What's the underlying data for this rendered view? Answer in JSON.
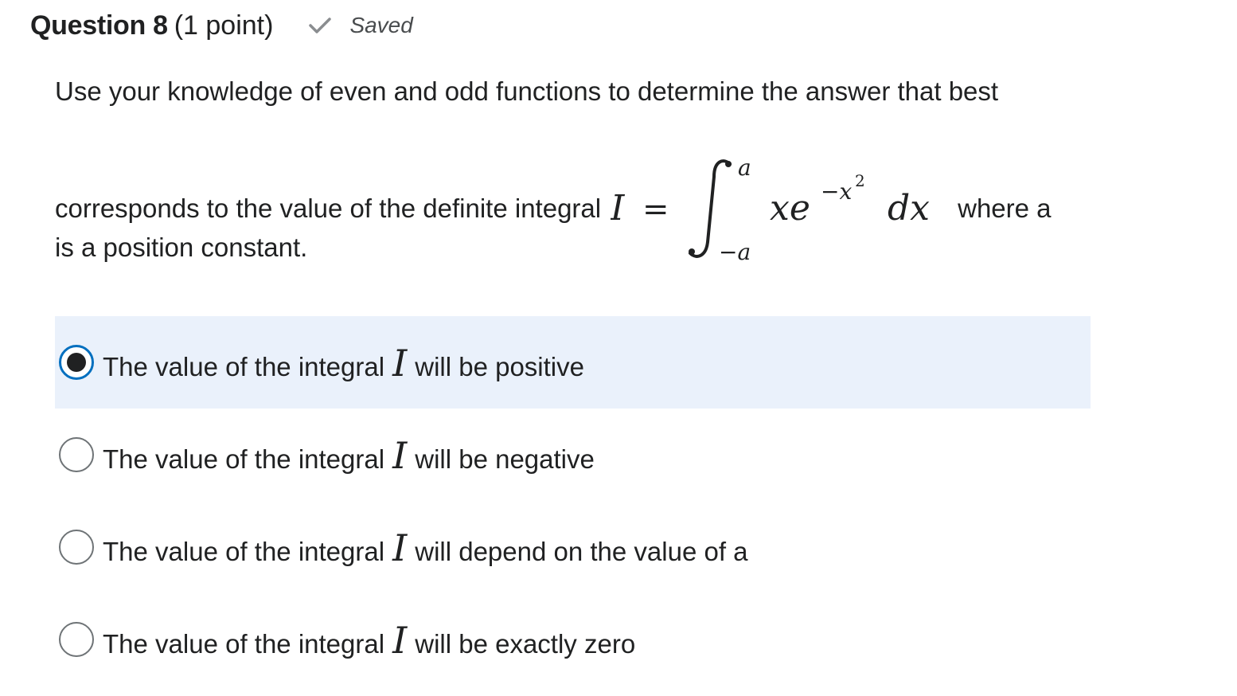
{
  "header": {
    "question_label": "Question 8",
    "points": "(1 point)",
    "status_icon": "check-icon",
    "status_text": "Saved"
  },
  "question": {
    "line1": "Use your knowledge of even and odd functions to determine the answer that best",
    "line2_prefix": "corresponds to the value of the definite integral",
    "formula": {
      "lhs": "I",
      "equals": "=",
      "upper_limit": "a",
      "lower_limit": "−a",
      "integrand_base": "xe",
      "exponent": "−x",
      "exponent_power": "2",
      "differential": "dx"
    },
    "line2_suffix": "where a",
    "line3": "is a position constant."
  },
  "options": [
    {
      "prefix": "The value of the integral",
      "symbol": "I",
      "suffix": "will be positive",
      "selected": true
    },
    {
      "prefix": "The value of the integral",
      "symbol": "I",
      "suffix": "will be negative",
      "selected": false
    },
    {
      "prefix": "The value of the integral",
      "symbol": "I",
      "suffix": "will depend on the value of a",
      "selected": false
    },
    {
      "prefix": "The value of the integral",
      "symbol": "I",
      "suffix": "will be exactly zero",
      "selected": false
    }
  ],
  "colors": {
    "selected_background": "#eaf1fb",
    "radio_selected_border": "#006fbf",
    "text": "#202122",
    "saved_text": "#494c4e"
  }
}
